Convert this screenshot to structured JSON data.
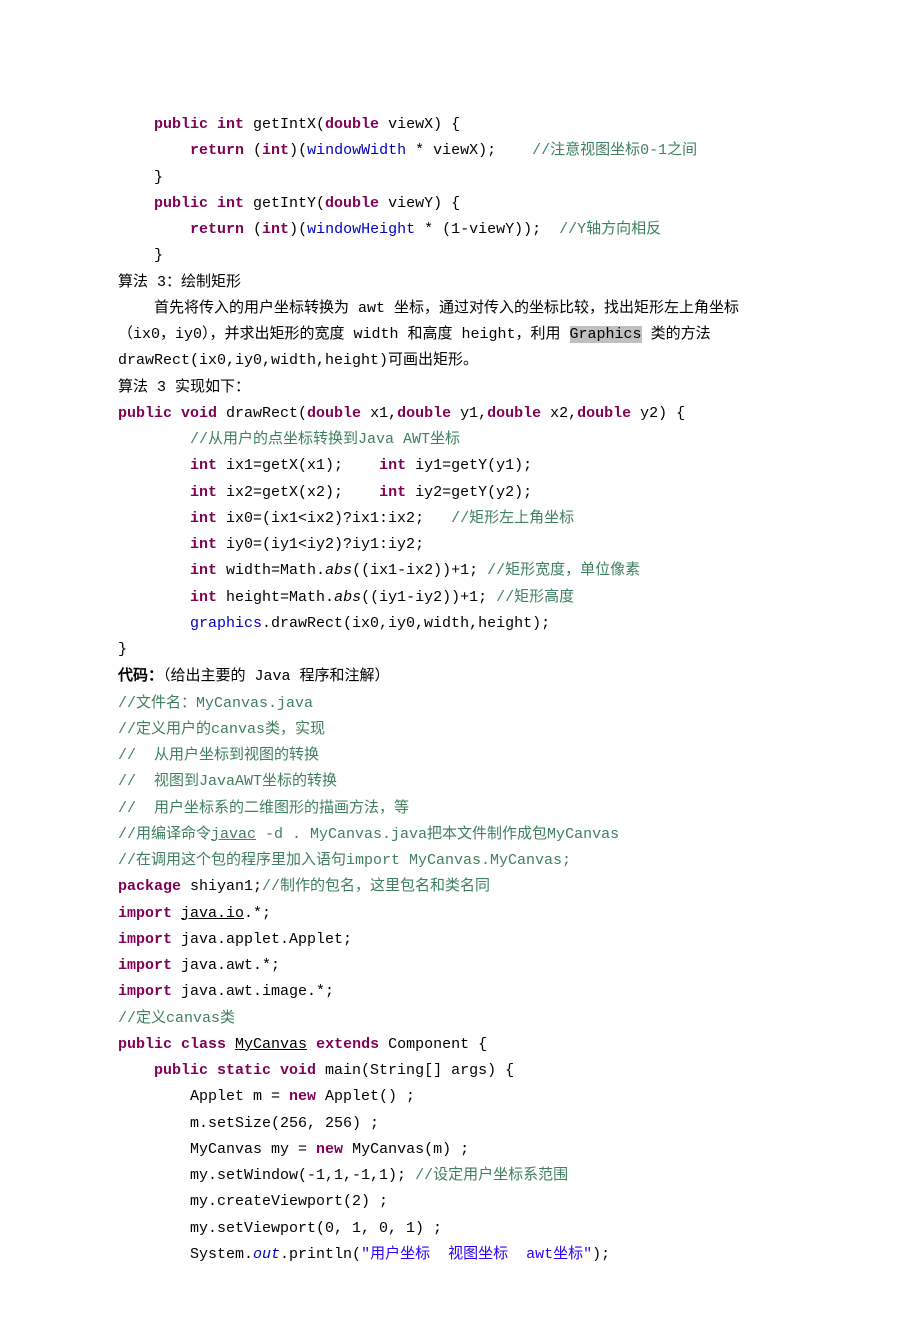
{
  "lines": [
    {
      "indent": 4,
      "parts": [
        {
          "c": "kw",
          "t": "public int"
        },
        {
          "t": " getIntX("
        },
        {
          "c": "kw",
          "t": "double"
        },
        {
          "t": " viewX) {"
        }
      ]
    },
    {
      "indent": 8,
      "parts": [
        {
          "c": "kw",
          "t": "return"
        },
        {
          "t": " ("
        },
        {
          "c": "kw",
          "t": "int"
        },
        {
          "t": ")("
        },
        {
          "c": "fld",
          "t": "windowWidth"
        },
        {
          "t": " * viewX);    "
        },
        {
          "c": "cmt",
          "t": "//注意视图坐标0-1之间"
        }
      ]
    },
    {
      "indent": 4,
      "parts": [
        {
          "t": "}"
        }
      ]
    },
    {
      "indent": 4,
      "parts": [
        {
          "c": "kw",
          "t": "public int"
        },
        {
          "t": " getIntY("
        },
        {
          "c": "kw",
          "t": "double"
        },
        {
          "t": " viewY) {"
        }
      ]
    },
    {
      "indent": 8,
      "parts": [
        {
          "c": "kw",
          "t": "return"
        },
        {
          "t": " ("
        },
        {
          "c": "kw",
          "t": "int"
        },
        {
          "t": ")("
        },
        {
          "c": "fld",
          "t": "windowHeight"
        },
        {
          "t": " * (1-viewY));  "
        },
        {
          "c": "cmt",
          "t": "//Y轴方向相反"
        }
      ]
    },
    {
      "indent": 4,
      "parts": [
        {
          "t": "}"
        }
      ]
    },
    {
      "indent": 0,
      "parts": [
        {
          "t": "算法 3：绘制矩形"
        }
      ]
    },
    {
      "indent": 4,
      "parts": [
        {
          "t": "首先将传入的用户坐标转换为 awt 坐标，通过对传入的坐标比较，找出矩形左上角坐标"
        }
      ]
    },
    {
      "indent": 0,
      "parts": [
        {
          "t": "（ix0，iy0），并求出矩形的宽度 width 和高度 height，利用 "
        },
        {
          "c": "hl",
          "t": "Graphics"
        },
        {
          "t": " 类的方法"
        }
      ]
    },
    {
      "indent": 0,
      "parts": [
        {
          "t": "drawRect(ix0,iy0,width,height)可画出矩形。"
        }
      ]
    },
    {
      "indent": 0,
      "parts": [
        {
          "t": "算法 3 实现如下："
        }
      ]
    },
    {
      "indent": 0,
      "parts": [
        {
          "c": "kw",
          "t": "public void"
        },
        {
          "t": " drawRect("
        },
        {
          "c": "kw",
          "t": "double"
        },
        {
          "t": " x1,"
        },
        {
          "c": "kw",
          "t": "double"
        },
        {
          "t": " y1,"
        },
        {
          "c": "kw",
          "t": "double"
        },
        {
          "t": " x2,"
        },
        {
          "c": "kw",
          "t": "double"
        },
        {
          "t": " y2) {"
        }
      ]
    },
    {
      "indent": 8,
      "parts": [
        {
          "c": "cmt",
          "t": "//从用户的点坐标转换到Java AWT坐标"
        }
      ]
    },
    {
      "indent": 8,
      "parts": [
        {
          "c": "kw",
          "t": "int"
        },
        {
          "t": " ix1=getX(x1);    "
        },
        {
          "c": "kw",
          "t": "int"
        },
        {
          "t": " iy1=getY(y1);"
        }
      ]
    },
    {
      "indent": 8,
      "parts": [
        {
          "c": "kw",
          "t": "int"
        },
        {
          "t": " ix2=getX(x2);    "
        },
        {
          "c": "kw",
          "t": "int"
        },
        {
          "t": " iy2=getY(y2);"
        }
      ]
    },
    {
      "indent": 8,
      "parts": [
        {
          "c": "kw",
          "t": "int"
        },
        {
          "t": " ix0=(ix1<ix2)?ix1:ix2;   "
        },
        {
          "c": "cmt",
          "t": "//矩形左上角坐标"
        }
      ]
    },
    {
      "indent": 8,
      "parts": [
        {
          "c": "kw",
          "t": "int"
        },
        {
          "t": " iy0=(iy1<iy2)?iy1:iy2;"
        }
      ]
    },
    {
      "indent": 8,
      "parts": [
        {
          "c": "kw",
          "t": "int"
        },
        {
          "t": " width=Math."
        },
        {
          "c": "ital",
          "t": "abs"
        },
        {
          "t": "((ix1-ix2))+1; "
        },
        {
          "c": "cmt",
          "t": "//矩形宽度，单位像素"
        }
      ]
    },
    {
      "indent": 8,
      "parts": [
        {
          "c": "kw",
          "t": "int"
        },
        {
          "t": " height=Math."
        },
        {
          "c": "ital",
          "t": "abs"
        },
        {
          "t": "((iy1-iy2))+1; "
        },
        {
          "c": "cmt",
          "t": "//矩形高度"
        }
      ]
    },
    {
      "indent": 8,
      "parts": [
        {
          "c": "fld",
          "t": "graphics"
        },
        {
          "t": ".drawRect(ix0,iy0,width,height);"
        }
      ]
    },
    {
      "indent": 0,
      "parts": [
        {
          "t": "}"
        }
      ]
    },
    {
      "indent": 0,
      "parts": [
        {
          "c": "bold",
          "t": "代码："
        },
        {
          "t": "（给出主要的 Java 程序和注解）"
        }
      ]
    },
    {
      "indent": 0,
      "parts": [
        {
          "c": "cmt",
          "t": "//文件名：MyCanvas.java"
        }
      ]
    },
    {
      "indent": 0,
      "parts": [
        {
          "c": "cmt",
          "t": "//定义用户的canvas类，实现"
        }
      ]
    },
    {
      "indent": 0,
      "parts": [
        {
          "c": "cmt",
          "t": "//  从用户坐标到视图的转换"
        }
      ]
    },
    {
      "indent": 0,
      "parts": [
        {
          "c": "cmt",
          "t": "//  视图到JavaAWT坐标的转换"
        }
      ]
    },
    {
      "indent": 0,
      "parts": [
        {
          "c": "cmt",
          "t": "//  用户坐标系的二维图形的描画方法，等"
        }
      ]
    },
    {
      "indent": 0,
      "parts": [
        {
          "c": "cmt",
          "t": "//用编译命令"
        },
        {
          "c": "cmt ul",
          "t": "javac"
        },
        {
          "c": "cmt",
          "t": " -d . MyCanvas.java把本文件制作成包MyCanvas"
        }
      ]
    },
    {
      "indent": 0,
      "parts": [
        {
          "c": "cmt",
          "t": "//在调用这个包的程序里加入语句import MyCanvas.MyCanvas;"
        }
      ]
    },
    {
      "indent": 0,
      "parts": [
        {
          "c": "kw",
          "t": "package"
        },
        {
          "t": " shiyan1;"
        },
        {
          "c": "cmt",
          "t": "//制作的包名，这里包名和类名同"
        }
      ]
    },
    {
      "indent": 0,
      "parts": [
        {
          "c": "kw",
          "t": "import"
        },
        {
          "t": " "
        },
        {
          "c": "ul",
          "t": "java.io"
        },
        {
          "t": ".*;"
        }
      ]
    },
    {
      "indent": 0,
      "parts": [
        {
          "c": "kw",
          "t": "import"
        },
        {
          "t": " java.applet.Applet;"
        }
      ]
    },
    {
      "indent": 0,
      "parts": [
        {
          "c": "kw",
          "t": "import"
        },
        {
          "t": " java.awt.*;"
        }
      ]
    },
    {
      "indent": 0,
      "parts": [
        {
          "c": "kw",
          "t": "import"
        },
        {
          "t": " java.awt.image.*;"
        }
      ]
    },
    {
      "indent": 0,
      "parts": [
        {
          "c": "cmt",
          "t": "//定义canvas类"
        }
      ]
    },
    {
      "indent": 0,
      "parts": [
        {
          "c": "kw",
          "t": "public class"
        },
        {
          "t": " "
        },
        {
          "c": "ul",
          "t": "MyCanvas"
        },
        {
          "t": " "
        },
        {
          "c": "kw",
          "t": "extends"
        },
        {
          "t": " Component {"
        }
      ]
    },
    {
      "indent": 4,
      "parts": [
        {
          "c": "kw",
          "t": "public static void"
        },
        {
          "t": " main(String[] args) {"
        }
      ]
    },
    {
      "indent": 8,
      "parts": [
        {
          "t": "Applet m = "
        },
        {
          "c": "kw",
          "t": "new"
        },
        {
          "t": " Applet() ;"
        }
      ]
    },
    {
      "indent": 8,
      "parts": [
        {
          "t": "m.setSize(256, 256) ;"
        }
      ]
    },
    {
      "indent": 8,
      "parts": [
        {
          "t": "MyCanvas my = "
        },
        {
          "c": "kw",
          "t": "new"
        },
        {
          "t": " MyCanvas(m) ;"
        }
      ]
    },
    {
      "indent": 8,
      "parts": [
        {
          "t": "my.setWindow(-1,1,-1,1); "
        },
        {
          "c": "cmt",
          "t": "//设定用户坐标系范围"
        }
      ]
    },
    {
      "indent": 8,
      "parts": [
        {
          "t": "my.createViewport(2) ;"
        }
      ]
    },
    {
      "indent": 8,
      "parts": [
        {
          "t": "my.setViewport(0, 1, 0, 1) ;"
        }
      ]
    },
    {
      "indent": 8,
      "parts": [
        {
          "t": "System."
        },
        {
          "c": "fld ital",
          "t": "out"
        },
        {
          "t": ".println("
        },
        {
          "c": "str",
          "t": "\"用户坐标  视图坐标  awt坐标\""
        },
        {
          "t": ");"
        }
      ]
    }
  ]
}
